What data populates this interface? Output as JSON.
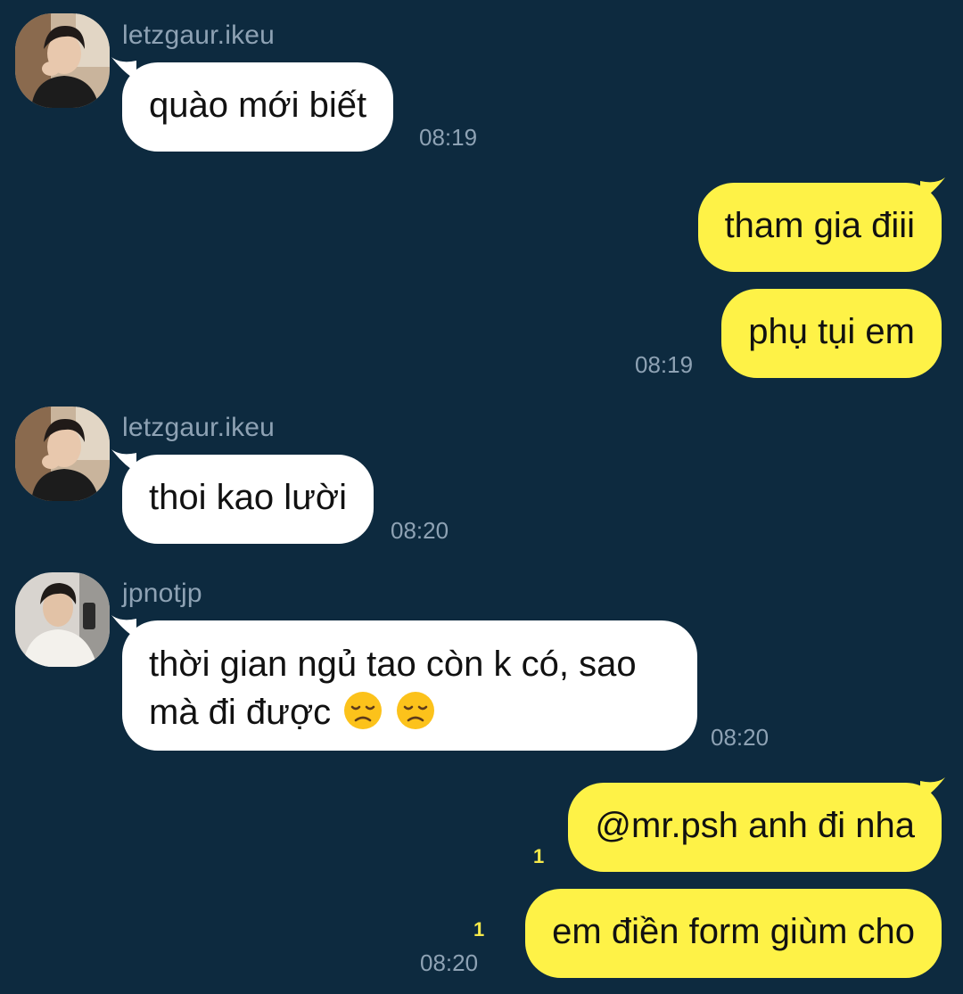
{
  "theme": {
    "background": "#0d2a3f",
    "incoming_bubble": "#ffffff",
    "outgoing_bubble": "#fef247",
    "meta_text": "#8ea2b4",
    "unread_count": "#f5e94a"
  },
  "messages": [
    {
      "sender": "letzgaur.ikeu",
      "text": "quào mới biết",
      "time": "08:19"
    },
    {
      "text": "tham gia điii"
    },
    {
      "text": "phụ tụi em",
      "time": "08:19"
    },
    {
      "sender": "letzgaur.ikeu",
      "text": "thoi kao lười",
      "time": "08:20"
    },
    {
      "sender": "jpnotjp",
      "text": "thời gian ngủ tao còn k có, sao mà đi được",
      "emoji": "disappointed-face-icon",
      "time": "08:20"
    },
    {
      "text": "@mr.psh anh đi nha",
      "unread": "1"
    },
    {
      "text": "em điền form giùm cho",
      "unread": "1",
      "time": "08:20"
    }
  ]
}
